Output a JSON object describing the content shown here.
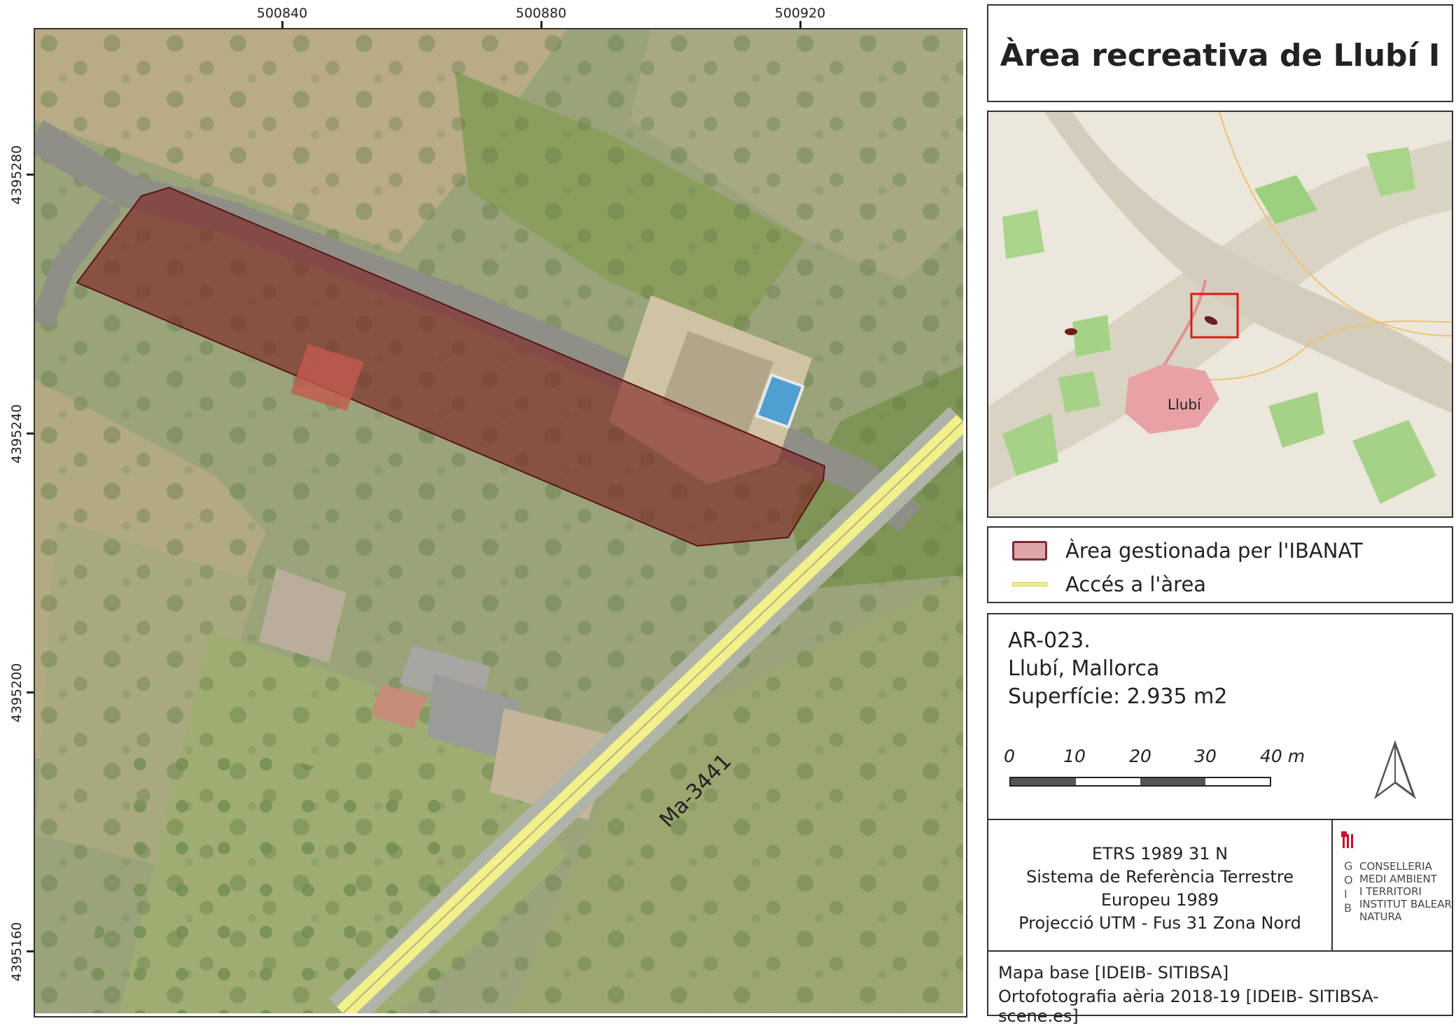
{
  "title": "Àrea recreativa de Llubí I",
  "map": {
    "coords_x": [
      "500840",
      "500880",
      "500920"
    ],
    "coords_y": [
      "4395280",
      "4395240",
      "4395200",
      "4395160"
    ],
    "road_label": "Ma-3441",
    "area_color": "#8b2e2e"
  },
  "overview": {
    "town_label": "Llubí"
  },
  "legend": {
    "items": [
      {
        "label": "Àrea gestionada per l'IBANAT",
        "icon": "polygon-swatch",
        "color": "#dca5a8"
      },
      {
        "label": "Accés a l'àrea",
        "icon": "line-swatch",
        "color": "#f1f08a"
      }
    ]
  },
  "info": {
    "code": "AR-023.",
    "location": "Llubí, Mallorca",
    "area": "Superfície: 2.935 m2"
  },
  "scalebar": {
    "labels": [
      "0",
      "10",
      "20",
      "30",
      "40 m"
    ]
  },
  "crs": {
    "lines": [
      "ETRS 1989 31 N",
      "Sistema de Referència Terrestre",
      "Europeu 1989",
      "Projecció UTM - Fus 31 Zona Nord"
    ]
  },
  "logo": {
    "letters": [
      "G",
      "O",
      "I",
      "B"
    ],
    "lines": [
      "CONSELLERIA",
      "MEDI AMBIENT",
      "I TERRITORI",
      "INSTITUT BALEAR",
      "NATURA"
    ]
  },
  "source": {
    "lines": [
      "Mapa base [IDEIB- SITIBSA]",
      "Ortofotografia aèria 2018-19 [IDEIB- SITIBSA-scene.es]"
    ]
  },
  "icons": {
    "north_arrow": "north-arrow-icon"
  }
}
